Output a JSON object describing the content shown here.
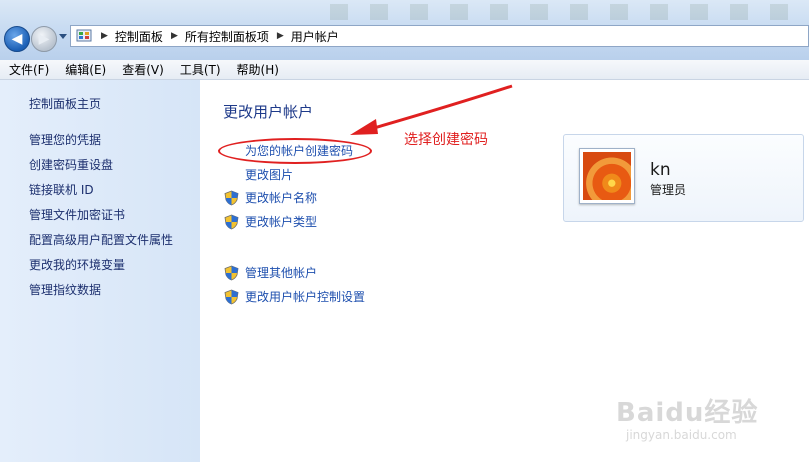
{
  "address_bar": {
    "breadcrumbs": [
      "控制面板",
      "所有控制面板项",
      "用户帐户"
    ]
  },
  "menu": [
    "文件(F)",
    "编辑(E)",
    "查看(V)",
    "工具(T)",
    "帮助(H)"
  ],
  "left_pane": {
    "items": [
      "控制面板主页",
      "管理您的凭据",
      "创建密码重设盘",
      "链接联机 ID",
      "管理文件加密证书",
      "配置高级用户配置文件属性",
      "更改我的环境变量",
      "管理指纹数据"
    ]
  },
  "main": {
    "heading": "更改用户帐户",
    "tasks": [
      "为您的帐户创建密码",
      "更改图片",
      "更改帐户名称",
      "更改帐户类型"
    ],
    "other_tasks": [
      "管理其他帐户",
      "更改用户帐户控制设置"
    ],
    "annotation": "选择创建密码"
  },
  "user": {
    "name": "kn",
    "role": "管理员"
  },
  "watermark": {
    "brand": "Baidu经验",
    "url": "jingyan.baidu.com"
  },
  "colors": {
    "annotation": "#e02020",
    "link": "#1e4fae",
    "left_pane": "#dbe8f8"
  }
}
